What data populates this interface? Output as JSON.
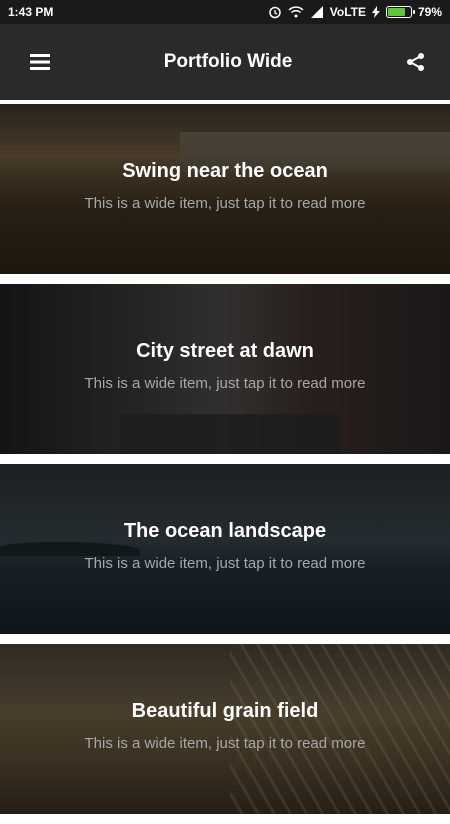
{
  "status_bar": {
    "time": "1:43 PM",
    "network": "VoLTE",
    "battery": "79%",
    "battery_level": 0.79,
    "icons": [
      "alarm-icon",
      "wifi-icon",
      "signal-icon",
      "charging-icon",
      "battery-icon"
    ]
  },
  "app_bar": {
    "title": "Portfolio Wide",
    "menu_icon": "menu-icon",
    "share_icon": "share-icon"
  },
  "items": [
    {
      "title": "Swing near the ocean",
      "subtitle": "This is a wide item, just tap it to read more"
    },
    {
      "title": "City street at dawn",
      "subtitle": "This is a wide item, just tap it to read more"
    },
    {
      "title": "The ocean landscape",
      "subtitle": "This is a wide item, just tap it to read more"
    },
    {
      "title": "Beautiful grain field",
      "subtitle": "This is a wide item, just tap it to read more"
    }
  ],
  "colors": {
    "app_bar": "#2a2a2a",
    "status_bar": "#1a1a1a",
    "battery": "#5ec73a"
  }
}
